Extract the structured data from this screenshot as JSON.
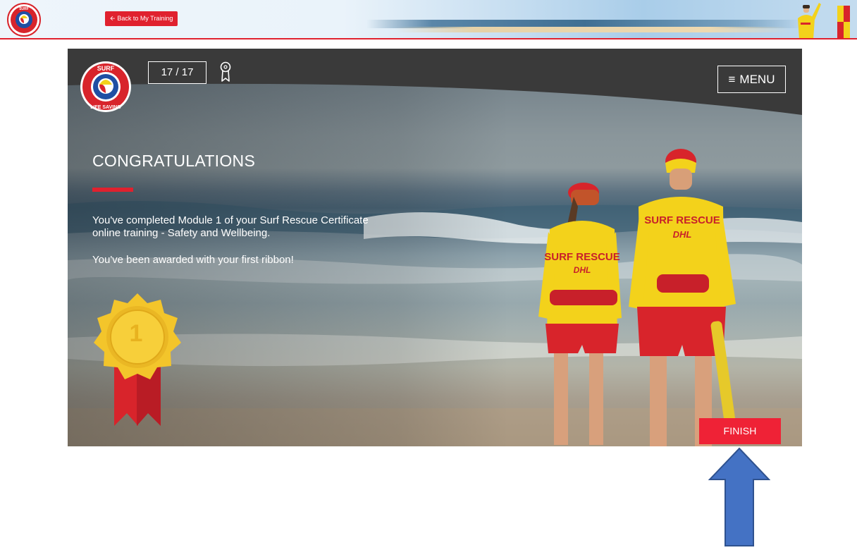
{
  "topbar": {
    "back_label": "Back to My Training",
    "back_icon": "arrow-left-icon",
    "logo_text_top": "SURF",
    "logo_text_bottom": "LIFE SAVING"
  },
  "slide": {
    "progress": "17 / 17",
    "ribbon_icon": "ribbon-icon",
    "menu_label": "MENU",
    "menu_icon": "hamburger-icon",
    "title": "CONGRATULATIONS",
    "paragraphs": [
      "You've completed Module 1 of your Surf Rescue Certificate online training - Safety and Wellbeing.",
      "You've been awarded with your first ribbon!"
    ],
    "medal_number": "1",
    "finish_label": "FINISH",
    "shirt_text_left": "SURF RESCUE",
    "shirt_text_right": "SURF RESCUE",
    "shirt_sponsor": "DHL"
  },
  "annotation": {
    "arrow_color": "#4472c4",
    "arrow_icon": "up-arrow-icon"
  },
  "colors": {
    "brand_red": "#e0212e",
    "finish_red": "#ef2236",
    "medal_gold": "#f5c431",
    "lifeguard_yellow": "#f3d21b",
    "lifeguard_red": "#d8242b"
  }
}
